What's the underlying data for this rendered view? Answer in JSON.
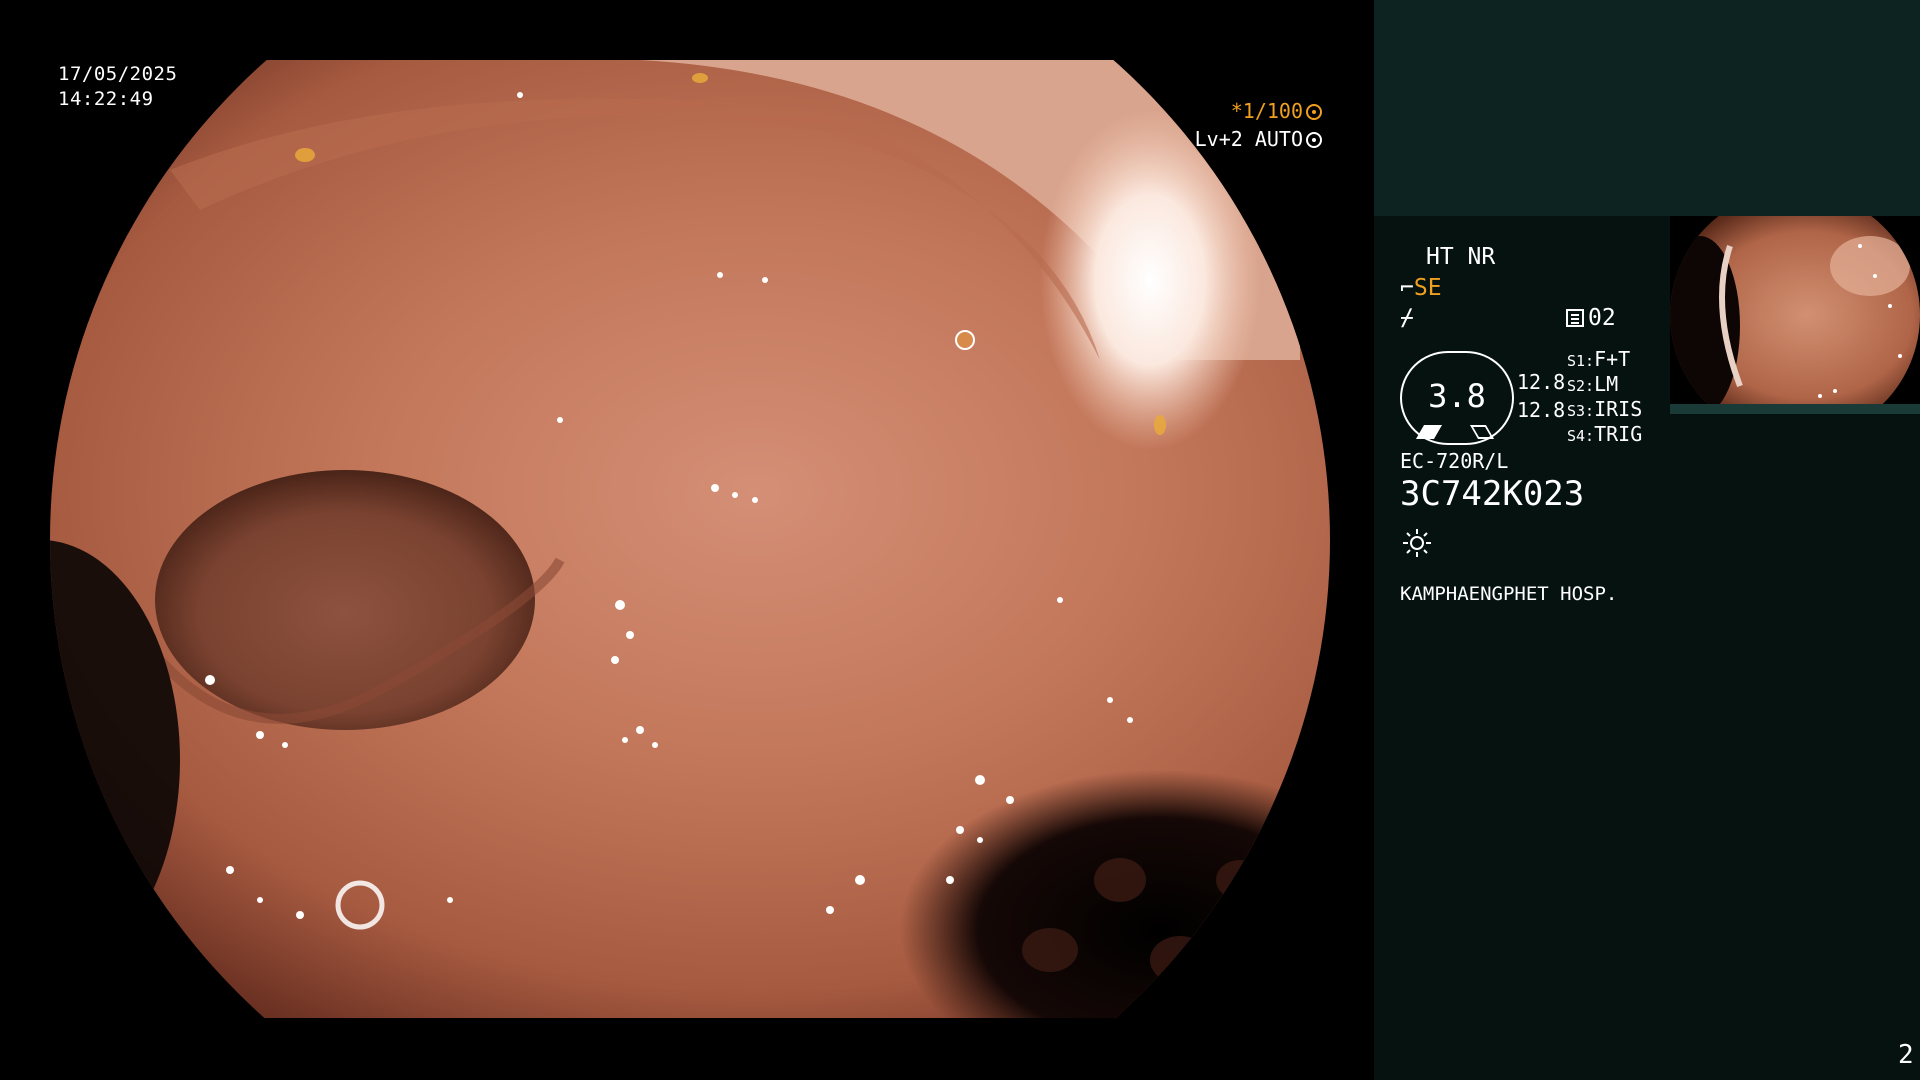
{
  "view": {
    "date": "17/05/2025",
    "time": "14:22:49",
    "shutter": "*1/100",
    "light": "Lv+2 AUTO"
  },
  "panel": {
    "ht_nr": "HT NR",
    "se_label": "SE",
    "enh_symbol": "⌿",
    "rec_count": "02",
    "magnification": "3.8",
    "value_1": "12.8",
    "value_2": "12.8",
    "switches": [
      {
        "key": "S1:",
        "value": "F+T"
      },
      {
        "key": "S2:",
        "value": "LM"
      },
      {
        "key": "S3:",
        "value": "IRIS"
      },
      {
        "key": "S4:",
        "value": "TRIG"
      }
    ],
    "scope_model": "EC-720R/L",
    "scope_serial": "3C742K023",
    "hospital": "KAMPHAENGPHET HOSP.",
    "page_number": "2"
  },
  "colors": {
    "panel_bg": "#051210",
    "panel_top_bg": "#0c2322",
    "accent_orange": "#f0a020"
  },
  "icons": {
    "shutter_icon": "aperture-icon",
    "light_icon": "target-icon",
    "se_icon": "scope-tip-icon",
    "rec_icon": "record-list-icon",
    "sun_icon": "sun-icon"
  }
}
